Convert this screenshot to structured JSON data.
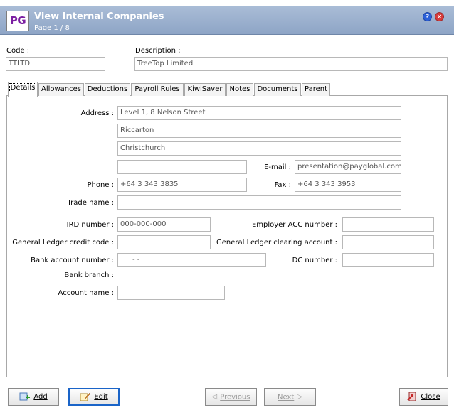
{
  "window": {
    "logo_text": "PG",
    "title": "View Internal Companies",
    "subtitle": "Page 1 / 8",
    "help_icon_glyph": "?",
    "close_icon_glyph": "×"
  },
  "header": {
    "code_label": "Code :",
    "code_value": "TTLTD",
    "description_label": "Description :",
    "description_value": "TreeTop Limited"
  },
  "tabs": [
    "Details",
    "Allowances",
    "Deductions",
    "Payroll Rules",
    "KiwiSaver",
    "Notes",
    "Documents",
    "Parent"
  ],
  "active_tab": "Details",
  "details": {
    "address_label": "Address :",
    "address_line1": "Level 1, 8 Nelson Street",
    "address_line2": "Riccarton",
    "address_line3": "Christchurch",
    "address_line4": "",
    "email_label": "E-mail :",
    "email_value": "presentation@payglobal.com",
    "phone_label": "Phone :",
    "phone_value": "+64 3 343 3835",
    "fax_label": "Fax :",
    "fax_value": "+64 3 343 3953",
    "trade_name_label": "Trade name :",
    "trade_name_value": "",
    "ird_label": "IRD number :",
    "ird_value": "000-000-000",
    "employer_acc_label": "Employer ACC number :",
    "employer_acc_value": "",
    "gl_credit_label": "General Ledger credit code :",
    "gl_credit_value": "",
    "gl_clearing_label": "General Ledger clearing account :",
    "gl_clearing_value": "",
    "bank_account_label": "Bank account number :",
    "bank_account_value": "-        -",
    "dc_number_label": "DC number :",
    "dc_number_value": "",
    "bank_branch_label": "Bank branch :",
    "account_name_label": "Account name :",
    "account_name_value": ""
  },
  "buttons": {
    "add": "Add",
    "edit": "Edit",
    "previous": "Previous",
    "next": "Next",
    "close": "Close"
  },
  "icons": {
    "help": "help-icon",
    "close_window": "close-icon",
    "add": "add-icon",
    "edit": "edit-icon",
    "previous": "arrow-left-icon",
    "next": "arrow-right-icon",
    "close": "close-door-icon"
  },
  "colors": {
    "titlebar": "#8ea5c6",
    "logo_purple": "#7b1fa2",
    "logo_blue": "#009ae0",
    "focus_border": "#1a64c8"
  }
}
